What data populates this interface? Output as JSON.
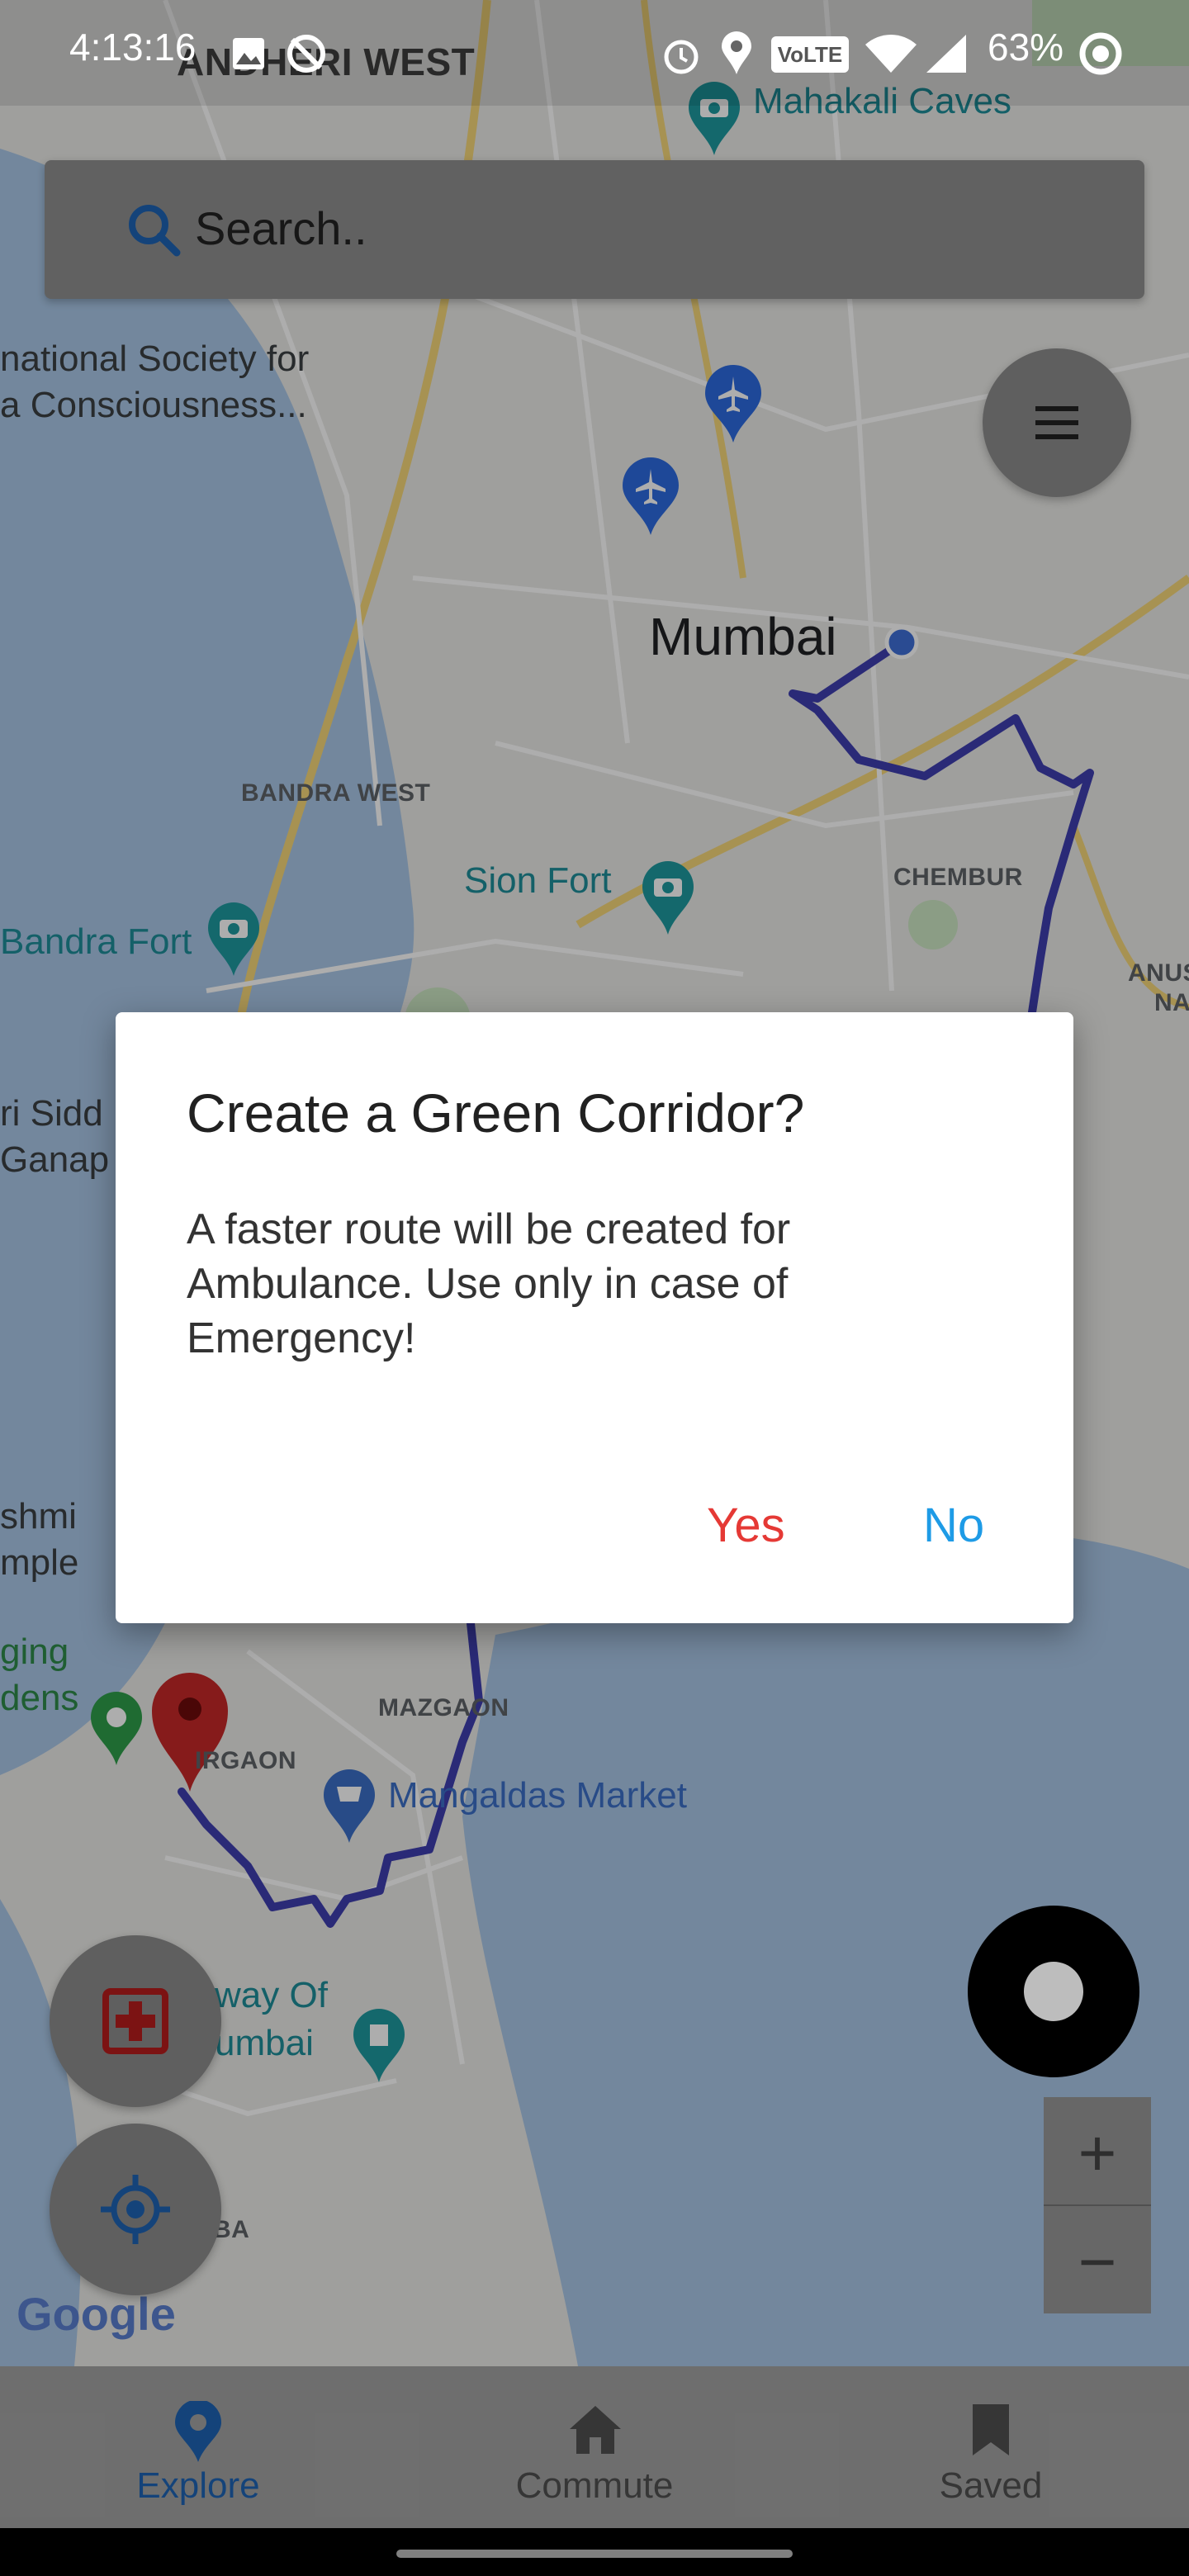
{
  "status_bar": {
    "time": "4:13:16",
    "battery": "63%",
    "volte_label": "VoLTE",
    "icons": [
      "image-icon",
      "sync-off-icon",
      "alarm-icon",
      "location-icon",
      "volte-icon",
      "wifi-icon",
      "signal-icon",
      "battery-icon"
    ]
  },
  "search": {
    "placeholder": "Search.."
  },
  "map": {
    "labels": {
      "andheri_west": "ANDHERI WEST",
      "mahakali_caves": "Mahakali Caves",
      "intl_society_1": "national Society for",
      "intl_society_2": "a Consciousness...",
      "mumbai": "Mumbai",
      "bandra_west": "BANDRA WEST",
      "sion_fort": "Sion Fort",
      "chembur": "CHEMBUR",
      "bandra_fort": "Bandra Fort",
      "anushakti_1": "ANUSHA",
      "anushakti_2": "NAGA",
      "siddhi_1": "ri Sidd",
      "siddhi_2": "Ganap",
      "lakshmi_1": "shmi",
      "lakshmi_2": "mple",
      "hanging_1": "ging",
      "hanging_2": "dens",
      "mazgaon": "MAZGAON",
      "girgaon": "IRGAON",
      "mangaldas": "Mangaldas Market",
      "gateway_1": "way Of",
      "gateway_2": "umbai",
      "colaba": "BA",
      "google": "Google"
    },
    "colors": {
      "route": "#3f3fb0",
      "land": "#eaeae7",
      "water": "#aac8e8",
      "road": "#ffffff",
      "highway": "#f6d77a",
      "park": "#cde8c4"
    }
  },
  "dialog": {
    "title": "Create a Green Corridor?",
    "message": "A faster route will be created for Ambulance. Use only in case of Emergency!",
    "yes_label": "Yes",
    "no_label": "No",
    "yes_color": "#e53935",
    "no_color": "#1e9be6"
  },
  "controls": {
    "zoom_in": "+",
    "zoom_out": "−"
  },
  "bottom_nav": {
    "items": [
      {
        "label": "Explore",
        "icon": "location-pin-icon",
        "active": true
      },
      {
        "label": "Commute",
        "icon": "home-icon",
        "active": false
      },
      {
        "label": "Saved",
        "icon": "bookmark-icon",
        "active": false
      }
    ],
    "active_color": "#1e64b4"
  }
}
